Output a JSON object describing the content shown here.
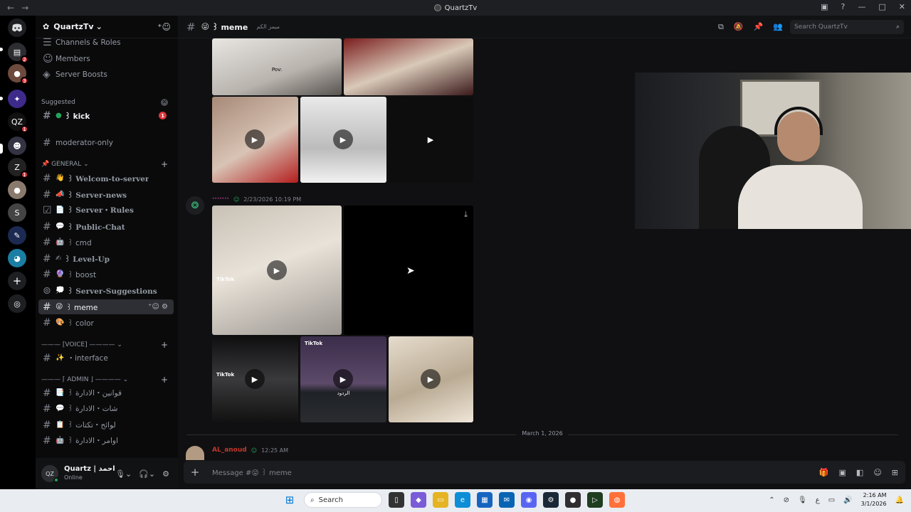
{
  "window": {
    "title": "QuartzTv",
    "back": "←",
    "forward": "→"
  },
  "server": {
    "name": "QuartzTv"
  },
  "sidebar": {
    "top_items": [
      {
        "label": "Channels & Roles",
        "icon": "list-icon"
      },
      {
        "label": "Members",
        "icon": "members-icon"
      },
      {
        "label": "Server Boosts",
        "icon": "boost-icon"
      }
    ],
    "suggested_label": "Suggested",
    "suggested_item": {
      "label": "꒱ kick",
      "badge": "1"
    },
    "moderator": "moderator-only",
    "general_label": "📌 GENERAL ⌄",
    "general": [
      {
        "emoji": "👋",
        "label": "꒱ Welcom-to-server"
      },
      {
        "emoji": "📣",
        "label": "꒱ Server-news"
      },
      {
        "emoji": "📄",
        "label": "꒱ Server・Rules"
      },
      {
        "emoji": "💬",
        "label": "꒱ Public-Chat"
      },
      {
        "emoji": "🤖",
        "label": "꒱ cmd"
      },
      {
        "emoji": "✍",
        "label": "꒱ Level-Up"
      },
      {
        "emoji": "🔮",
        "label": "꒱ boost"
      },
      {
        "emoji": "💭",
        "label": "꒱ Server-Suggestions"
      },
      {
        "emoji": "😜",
        "label": "꒱ meme"
      },
      {
        "emoji": "🎨",
        "label": "꒱ color"
      }
    ],
    "voice_label": "——— [VOICE] ———— ⌄",
    "voice": [
      {
        "emoji": "✨",
        "label": "・interface"
      }
    ],
    "admin_label": "——— ⌈ ADMIN ⌋ ———— ⌄",
    "admin": [
      {
        "emoji": "📑",
        "label": "꒱ قوانين・الادارة"
      },
      {
        "emoji": "💬",
        "label": "꒱ شات・الادارة"
      },
      {
        "emoji": "📋",
        "label": "꒱ لوائح・تكتات"
      },
      {
        "emoji": "🤖",
        "label": "꒱ اوامر・الادارة"
      }
    ]
  },
  "user": {
    "name": "Quartz | احمد",
    "status": "Online"
  },
  "channel": {
    "name": "꒱ meme",
    "topic": "ميمز الكم",
    "search_placeholder": "Search QuartzTv"
  },
  "message": {
    "time": "2/23/2026 10:19 PM",
    "username": "·······"
  },
  "media": {
    "tiktok": "TikTok",
    "caption1": "Pov:",
    "caption_ar": "الردود"
  },
  "date_separator": "March 1, 2026",
  "next_message": {
    "username": "AL_anoud",
    "time": "12:25 AM"
  },
  "composer": {
    "placeholder": "Message #😜 ꒱ meme"
  },
  "taskbar": {
    "search": "Search",
    "lang": "ع",
    "time": "2:16 AM",
    "date": "3/1/2026"
  },
  "colors": {
    "accent": "#5865f2",
    "danger": "#da373c",
    "online": "#23a55a"
  }
}
